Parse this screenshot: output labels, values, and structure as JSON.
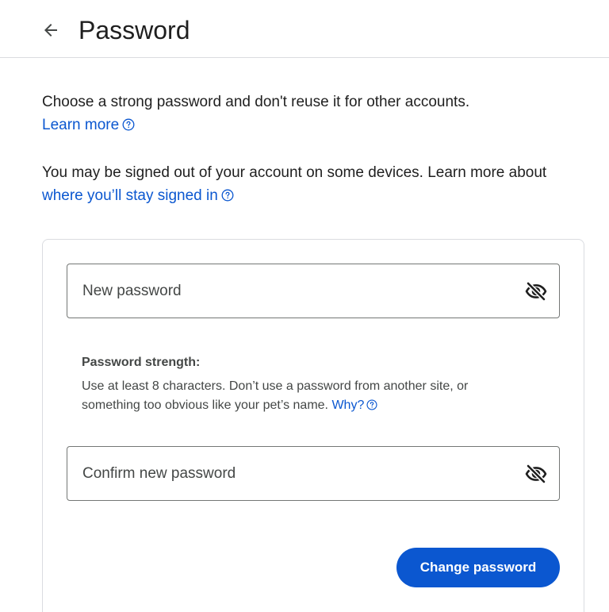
{
  "header": {
    "title": "Password",
    "back_icon": "arrow-left-icon"
  },
  "intro": {
    "text": "Choose a strong password and don't reuse it for other accounts.",
    "link": "Learn more",
    "help_icon": "help-circle-icon"
  },
  "signout": {
    "text": "You may be signed out of your account on some devices. Learn more about",
    "link": "where you’ll stay signed in",
    "help_icon": "help-circle-icon"
  },
  "form": {
    "new_password": {
      "placeholder": "New password",
      "value": "",
      "toggle_icon": "eye-off-icon"
    },
    "strength": {
      "label": "Password strength:",
      "text": "Use at least 8 characters. Don’t use a password from another site, or something too obvious like your pet’s name.",
      "link": "Why?",
      "help_icon": "help-circle-icon"
    },
    "confirm_password": {
      "placeholder": "Confirm new password",
      "value": "",
      "toggle_icon": "eye-off-icon"
    },
    "submit_label": "Change password"
  },
  "colors": {
    "accent": "#0b57d0",
    "text": "#1f1f1f",
    "secondary_text": "#444746",
    "border": "#dadce0",
    "field_border": "#747775"
  }
}
